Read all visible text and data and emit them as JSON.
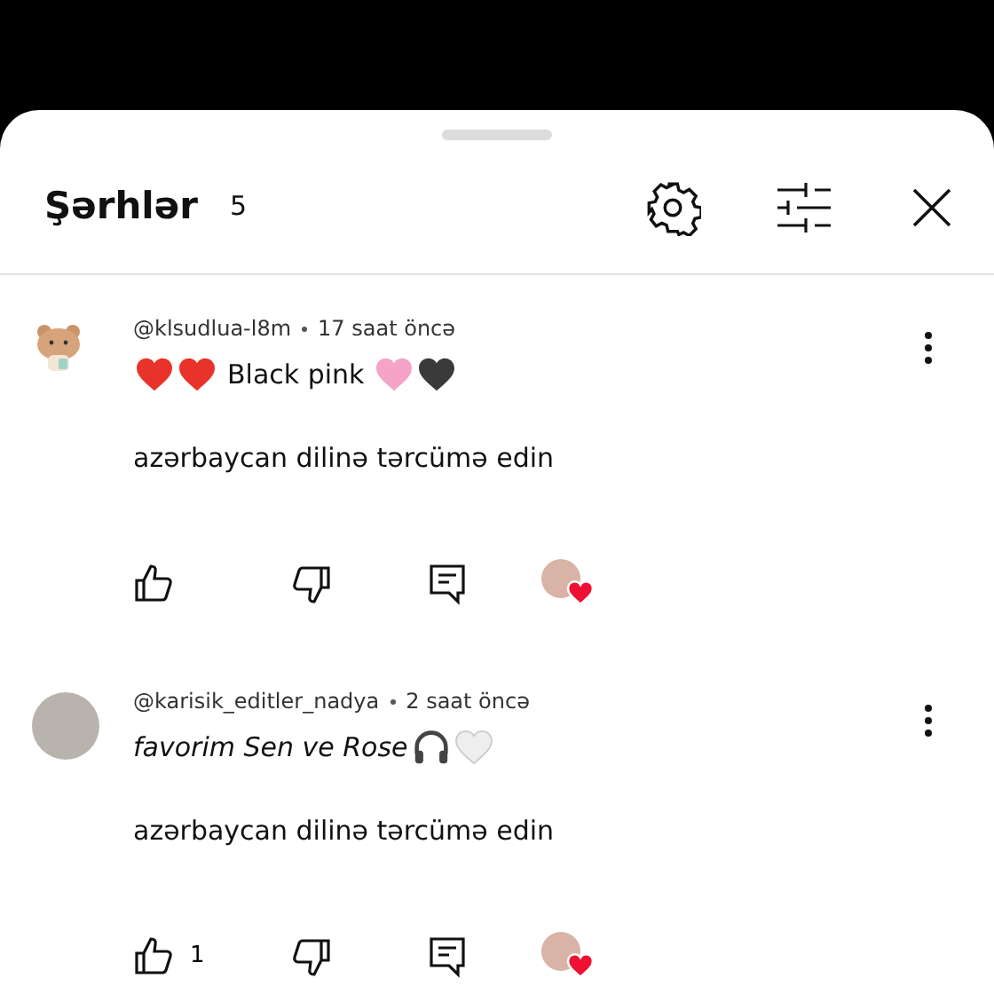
{
  "header": {
    "title": "Şərhlər",
    "count": "5"
  },
  "comments": [
    {
      "avatar": {
        "kind": "sticker"
      },
      "handle": "@klsudlua-l8m",
      "time": "17 saat öncə",
      "italic": false,
      "body": [
        {
          "kind": "heart",
          "color": "#e8332a"
        },
        {
          "kind": "heart",
          "color": "#e8332a"
        },
        {
          "kind": "text",
          "text": "Black pink"
        },
        {
          "kind": "heart",
          "color": "#f6a3c8"
        },
        {
          "kind": "heart",
          "color": "#3a3a3a"
        }
      ],
      "translate": "azərbaycan dilinə tərcümə edin",
      "creator_heart": true
    },
    {
      "avatar": {
        "kind": "photo"
      },
      "handle": "@karisik_editler_nadya",
      "time": "2 saat öncə",
      "italic": true,
      "body": [
        {
          "kind": "text",
          "text": "favorim Sen ve Rose"
        },
        {
          "kind": "headphones",
          "color": "#444444"
        },
        {
          "kind": "heart",
          "color": "#eeeeee"
        }
      ],
      "translate": "azərbaycan dilinə tərcümə edin",
      "likes": "1",
      "creator_heart": true
    }
  ]
}
